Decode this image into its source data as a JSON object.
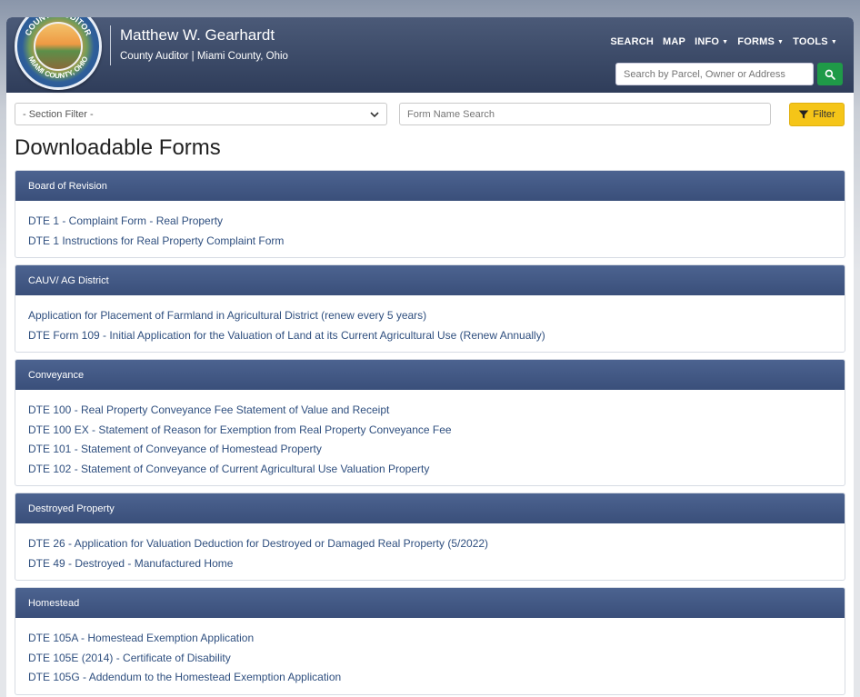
{
  "header": {
    "seal_text_top": "COUNTY AUDITOR",
    "seal_text_bottom": "MIAMI COUNTY, OHIO",
    "name": "Matthew W. Gearhardt",
    "subtitle": "County Auditor | Miami County, Ohio",
    "nav": [
      {
        "label": "SEARCH",
        "dropdown": false
      },
      {
        "label": "MAP",
        "dropdown": false
      },
      {
        "label": "INFO",
        "dropdown": true
      },
      {
        "label": "FORMS",
        "dropdown": true
      },
      {
        "label": "TOOLS",
        "dropdown": true
      }
    ],
    "search_placeholder": "Search by Parcel, Owner or Address",
    "search_icon": "search-icon"
  },
  "toolbar": {
    "section_filter_value": "- Section Filter -",
    "form_search_placeholder": "Form Name Search",
    "filter_label": "Filter",
    "filter_icon": "funnel-icon"
  },
  "title": "Downloadable Forms",
  "colors": {
    "header_bg": "#2f3d5a",
    "panel_head_bg": "#3a4f7a",
    "link": "#2f4f7f",
    "filter_btn": "#f5c518",
    "search_btn": "#1f9a48"
  },
  "sections": [
    {
      "heading": "Board of Revision",
      "links": [
        "DTE 1 - Complaint Form - Real Property",
        "DTE 1 Instructions for Real Property Complaint Form"
      ]
    },
    {
      "heading": "CAUV/ AG District",
      "links": [
        "Application for Placement of Farmland in Agricultural District (renew every 5 years)",
        "DTE Form 109 - Initial Application for the Valuation of Land at its Current Agricultural Use (Renew Annually)"
      ]
    },
    {
      "heading": "Conveyance",
      "links": [
        "DTE 100 - Real Property Conveyance Fee Statement of Value and Receipt",
        "DTE 100 EX - Statement of Reason for Exemption from Real Property Conveyance Fee",
        "DTE 101 - Statement of Conveyance of Homestead Property",
        "DTE 102 - Statement of Conveyance of Current Agricultural Use Valuation Property"
      ]
    },
    {
      "heading": "Destroyed Property",
      "links": [
        "DTE 26 - Application for Valuation Deduction for Destroyed or Damaged Real Property (5/2022)",
        "DTE 49 - Destroyed - Manufactured Home"
      ]
    },
    {
      "heading": "Homestead",
      "links": [
        "DTE 105A - Homestead Exemption Application",
        "DTE 105E (2014) - Certificate of Disability",
        "DTE 105G - Addendum to the Homestead Exemption Application"
      ]
    }
  ]
}
